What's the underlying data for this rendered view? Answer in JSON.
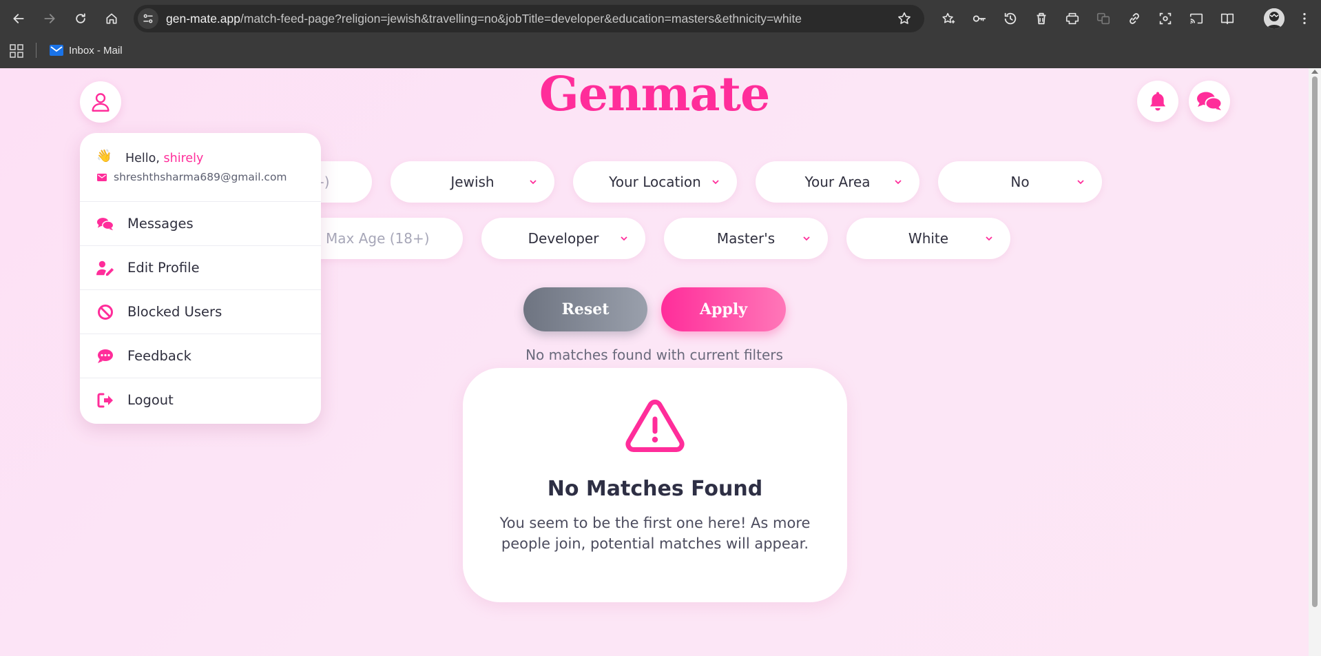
{
  "browser": {
    "url_host": "gen-mate.app",
    "url_path": "/match-feed-page?religion=jewish&travelling=no&jobTitle=developer&education=masters&ethnicity=white",
    "bookmarks": [
      {
        "label": "Inbox - Mail",
        "icon": "mail-icon"
      }
    ]
  },
  "app": {
    "logo": "Genmate",
    "brand_color": "#ff2d9a"
  },
  "filters": {
    "row1": [
      {
        "value": "-)",
        "placeholder": true
      },
      {
        "value": "Jewish"
      },
      {
        "value": "Your Location"
      },
      {
        "value": "Your Area"
      },
      {
        "value": "No"
      }
    ],
    "row2": [
      {
        "value": "Max Age (18+)",
        "placeholder": true
      },
      {
        "value": "Developer"
      },
      {
        "value": "Master's"
      },
      {
        "value": "White"
      }
    ]
  },
  "actions": {
    "reset_label": "Reset",
    "apply_label": "Apply"
  },
  "status_text": "No matches found with current filters",
  "empty_state": {
    "icon": "warning-triangle-icon",
    "title": "No Matches Found",
    "text": "You seem to be the first one here! As more people join, potential matches will appear."
  },
  "user_menu": {
    "greeting": "Hello,",
    "username": "shirely",
    "email": "shreshthsharma689@gmail.com",
    "items": [
      {
        "label": "Messages",
        "icon": "messages-icon"
      },
      {
        "label": "Edit Profile",
        "icon": "edit-profile-icon"
      },
      {
        "label": "Blocked Users",
        "icon": "blocked-icon"
      },
      {
        "label": "Feedback",
        "icon": "feedback-icon"
      },
      {
        "label": "Logout",
        "icon": "logout-icon"
      }
    ]
  }
}
